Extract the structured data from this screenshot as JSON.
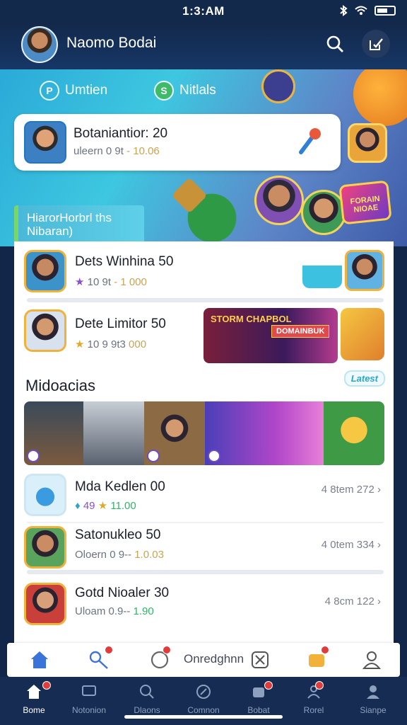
{
  "status_bar": {
    "time": "1:3:AM"
  },
  "header": {
    "user_name": "Naomo Bodai"
  },
  "hero": {
    "tabs": [
      {
        "label": "Umtien",
        "icon": "p-circle-icon"
      },
      {
        "label": "Nitlals",
        "icon": "s-chat-icon"
      }
    ],
    "featured": {
      "title": "Botaniantior: 20",
      "meta_prefix": "uleern 0 9t",
      "meta_value": "- 10.06"
    },
    "promo_badge": "FORAIN NIOAE",
    "section_tag": "HiarorHorbrl ths Nibaran)"
  },
  "list_top": [
    {
      "title": "Dets Winhina 50",
      "meta_prefix": "10 9t",
      "meta_value": "- 1 000"
    },
    {
      "title": "Dete Limitor 50",
      "meta_prefix": "10 9 9t3",
      "meta_value": "000"
    }
  ],
  "promo_banner": {
    "title": "STORM CHAPBOL",
    "tag": "DOMAINBUK"
  },
  "section": {
    "title": "Midoacias",
    "badge": "Latest"
  },
  "list_bottom": [
    {
      "title": "Mda Kedlen 00",
      "meta_prefix": "49",
      "meta_value": "11.00",
      "count": "4 8tem 272"
    },
    {
      "title": "Satonukleo 50",
      "meta_prefix": "Oloern 0 9--",
      "meta_value": "1.0.03",
      "count": "4 0tem 334"
    },
    {
      "title": "Gotd Nioaler 30",
      "meta_prefix": "Uloam 0.9--",
      "meta_value": "1.90",
      "count": "4 8cm 122"
    }
  ],
  "action_bar": {
    "label": "Onredghnn"
  },
  "tab_bar": {
    "tabs": [
      {
        "label": "Bome",
        "active": true
      },
      {
        "label": "Notonion"
      },
      {
        "label": "Dlaons"
      },
      {
        "label": "Comnon"
      },
      {
        "label": "Bobat"
      },
      {
        "label": "Rorel"
      },
      {
        "label": "Sianpe"
      }
    ]
  },
  "colors": {
    "accent": "#2aa6c8",
    "brand_dark": "#13294c",
    "highlight": "#c9a454",
    "success": "#2fb66b",
    "badge_red": "#e23b3b"
  }
}
